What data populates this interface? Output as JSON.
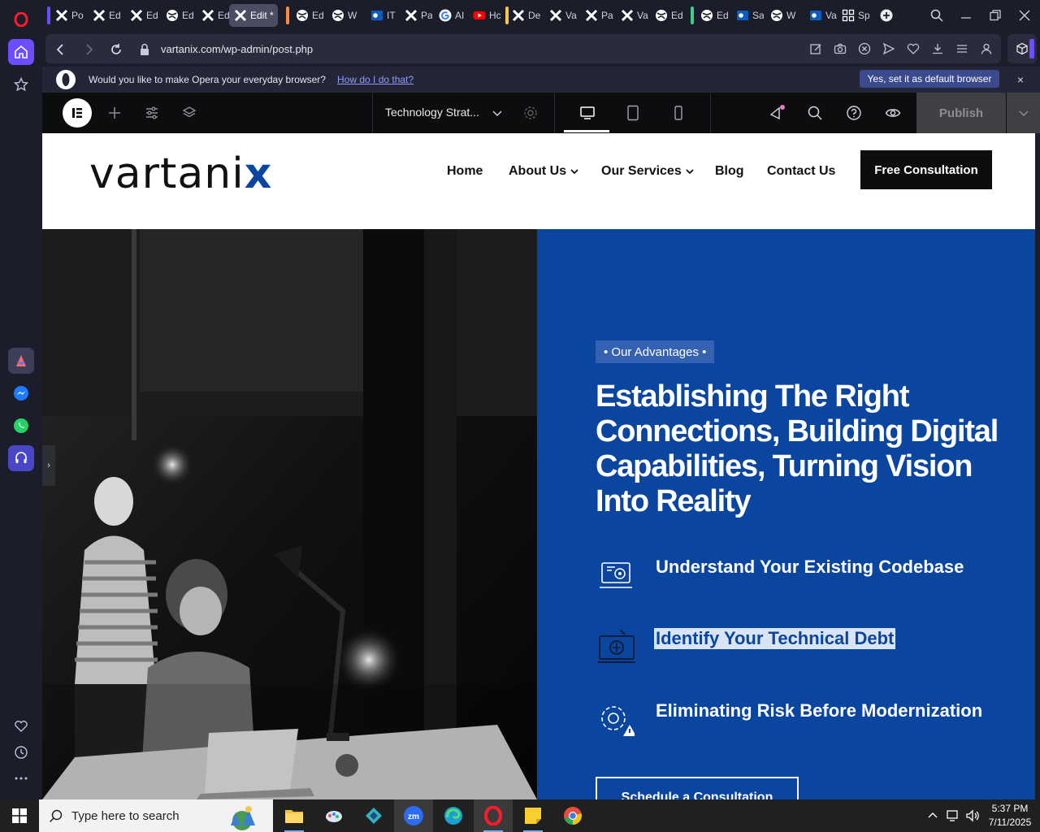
{
  "browser": {
    "tabs": [
      {
        "label": "Po",
        "icon": "x-logo-icon"
      },
      {
        "label": "Ed",
        "icon": "x-logo-icon"
      },
      {
        "label": "Ed",
        "icon": "x-logo-icon"
      },
      {
        "label": "Ed",
        "icon": "globe-icon"
      },
      {
        "label": "Ed",
        "icon": "x-logo-icon"
      },
      {
        "label": "Edit *",
        "icon": "x-logo-icon"
      },
      {
        "label": "Ed",
        "icon": "globe-icon"
      },
      {
        "label": "W",
        "icon": "globe-icon"
      },
      {
        "label": "IT",
        "icon": "outlook-icon"
      },
      {
        "label": "Pa",
        "icon": "x-logo-icon"
      },
      {
        "label": "AI",
        "icon": "google-icon"
      },
      {
        "label": "Hc",
        "icon": "youtube-icon"
      },
      {
        "label": "De",
        "icon": "x-logo-icon"
      },
      {
        "label": "Va",
        "icon": "x-logo-icon"
      },
      {
        "label": "Pa",
        "icon": "x-logo-icon"
      },
      {
        "label": "Va",
        "icon": "x-logo-icon"
      },
      {
        "label": "Ed",
        "icon": "globe-icon"
      },
      {
        "label": "Ed",
        "icon": "globe-icon"
      },
      {
        "label": "Sa",
        "icon": "outlook-icon"
      },
      {
        "label": "W",
        "icon": "globe-icon"
      },
      {
        "label": "Va",
        "icon": "outlook-icon"
      },
      {
        "label": "Sp",
        "icon": "grid-icon"
      }
    ],
    "url": "vartanix.com/wp-admin/post.php",
    "banner": {
      "text": "Would you like to make Opera your everyday browser?",
      "link": "How do I do that?",
      "button": "Yes, set it as default browser",
      "close": "×"
    },
    "colors": {
      "accent": "#6c4dff",
      "sidebar_active": "#6c4dff"
    }
  },
  "elementor": {
    "document_title": "Technology Strat...",
    "publish_label": "Publish"
  },
  "site": {
    "logo": {
      "text": "vartani",
      "accent": "x"
    },
    "menu": [
      {
        "label": "Home",
        "dropdown": false
      },
      {
        "label": "About Us",
        "dropdown": true
      },
      {
        "label": "Our Services",
        "dropdown": true
      },
      {
        "label": "Blog",
        "dropdown": false
      },
      {
        "label": "Contact Us",
        "dropdown": false
      }
    ],
    "cta": "Free Consultation",
    "hero": {
      "badge": "• Our Advantages •",
      "title": "Establishing The Right Connections, Building Digital Capabilities, Turning Vision Into Reality",
      "features": [
        {
          "label": "Understand Your Existing Codebase",
          "icon": "code-monitor-icon",
          "selected": false
        },
        {
          "label": "Identify Your Technical Debt",
          "icon": "debt-monitor-icon",
          "selected": true
        },
        {
          "label": "Eliminating Risk Before Modernization",
          "icon": "risk-gear-icon",
          "selected": false
        }
      ],
      "button": "Schedule a Consultation",
      "bg_color": "#0a45a0"
    }
  },
  "taskbar": {
    "search_placeholder": "Type here to search",
    "time": "5:37 PM",
    "date": "7/11/2025"
  }
}
